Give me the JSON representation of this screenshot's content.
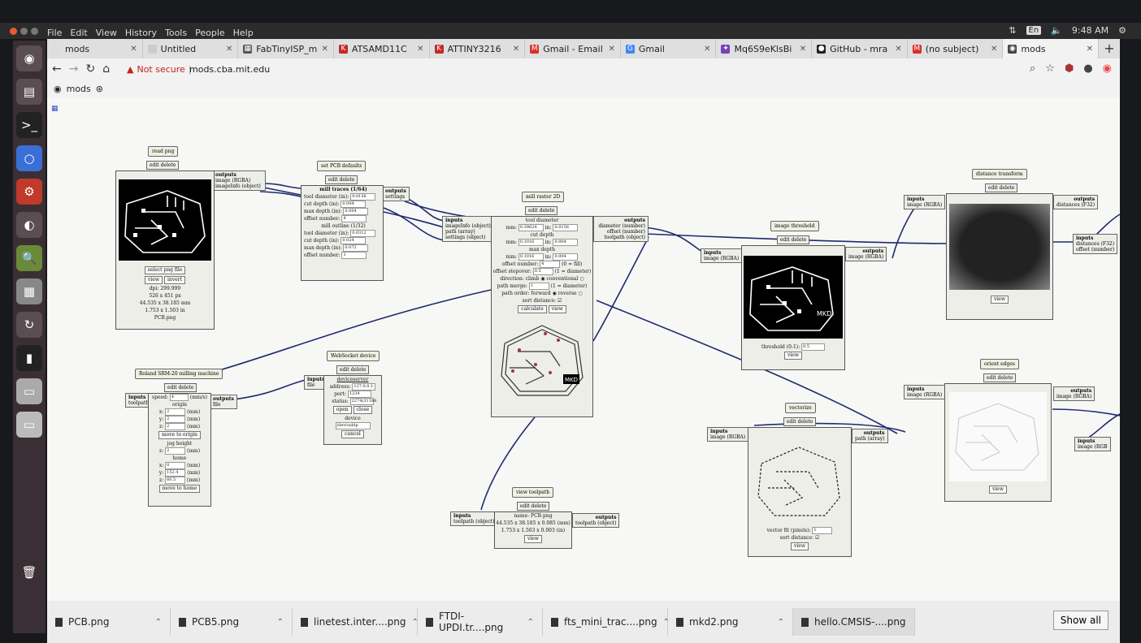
{
  "system": {
    "menu": [
      "File",
      "Edit",
      "View",
      "History",
      "Tools",
      "People",
      "Help"
    ],
    "lang": "En",
    "time": "9:48 AM"
  },
  "browser": {
    "tabs": [
      {
        "label": "mods",
        "icon": "mods-icon",
        "active": false
      },
      {
        "label": "Untitled",
        "icon": "page-icon",
        "active": false
      },
      {
        "label": "FabTinyISP_m",
        "icon": "doc-icon",
        "active": false
      },
      {
        "label": "ATSAMD11C",
        "icon": "k-icon",
        "active": false
      },
      {
        "label": "ATTINY3216",
        "icon": "k-icon",
        "active": false
      },
      {
        "label": "Gmail - Email",
        "icon": "gmail-icon",
        "active": false
      },
      {
        "label": "Gmail",
        "icon": "google-icon",
        "active": false
      },
      {
        "label": "Mq6S9eKlsBi",
        "icon": "puzzle-icon",
        "active": false
      },
      {
        "label": "GitHub - mra",
        "icon": "github-icon",
        "active": false
      },
      {
        "label": "(no subject)",
        "icon": "gmail-icon",
        "active": false
      },
      {
        "label": "mods",
        "icon": "mods-icon",
        "active": true
      }
    ],
    "security": "Not secure",
    "url": "mods.cba.mit.edu",
    "bookmark": "mods"
  },
  "modules": {
    "read_png": {
      "title": "read png",
      "edit": "edit delete",
      "outputs": "outputs",
      "out1": "image (RGBA)",
      "out2": "imageInfo (object)",
      "select": "select png file",
      "view": "view",
      "invert": "invert",
      "dpi": "dpi: 299.999",
      "px": "526 x 451 px",
      "mm": "44.535 x 38.185 mm",
      "in": "1.753 x 1.503 in",
      "name": "PCB.png"
    },
    "pcb_defaults": {
      "title": "set PCB defaults",
      "edit": "edit delete",
      "outputs": "outputs",
      "out1": "settings",
      "h1": "mill traces (1/64)",
      "r1": "tool diameter (in):",
      "v1": "0.0156",
      "r2": "cut depth (in):",
      "v2": "0.004",
      "r3": "max depth (in):",
      "v3": "0.004",
      "r4": "offset number:",
      "v4": "4",
      "h2": "mill outline (1/32)",
      "r5": "tool diameter (in):",
      "v5": "0.0312",
      "r6": "cut depth (in):",
      "v6": "0.024",
      "r7": "max depth (in):",
      "v7": "0.072",
      "r8": "offset number:",
      "v8": "1"
    },
    "raster": {
      "title": "mill raster 2D",
      "edit": "edit delete",
      "inputs": "inputs",
      "in1": "imageInfo (object)",
      "in2": "path (array)",
      "in3": "settings (object)",
      "outputs": "outputs",
      "out1": "diameter (number)",
      "out2": "offset (number)",
      "out3": "toolpath (object)",
      "h1": "tool diameter",
      "r1a": "mm:",
      "v1a": "0.39624",
      "r1b": "in:",
      "v1b": "0.0156",
      "h2": "cut depth",
      "r2a": "mm:",
      "v2a": "0.1016",
      "r2b": "in:",
      "v2b": "0.004",
      "h3": "max depth",
      "r3a": "mm:",
      "v3a": "0.1016",
      "r3b": "in:",
      "v3b": "0.004",
      "r4": "offset number:",
      "v4": "4",
      "r4n": "(0 = fill)",
      "r5": "offset stepover:",
      "v5": "0.5",
      "r5n": "(1 = diameter)",
      "r6": "direction: climb",
      "r6b": "conventional",
      "r7": "path merge:",
      "v7": "1",
      "r7n": "(1 = diameter)",
      "r8": "path order: forward",
      "r8b": "reverse",
      "r9": "sort distance:",
      "calc": "calculate",
      "view": "view",
      "mkd": "MKD"
    },
    "roland": {
      "title": "Roland SRM-20 milling machine",
      "edit": "edit delete",
      "inputs": "inputs",
      "in1": "toolpath",
      "outputs": "outputs",
      "out1": "file",
      "speed": "speed:",
      "speed_v": "4",
      "speed_u": "(mm/s)",
      "origin": "origin",
      "x": "x:",
      "x_v": "2",
      "y": "y:",
      "y_v": "2",
      "z": "z:",
      "z_v": "2",
      "unit": "(mm)",
      "move_origin": "move to origin",
      "jog": "jog height",
      "jog_z": "z:",
      "jog_v": "2",
      "home": "home",
      "hx_v": "0",
      "hy_v": "152.4",
      "hz_v": "60.5",
      "move_home": "move to home"
    },
    "websocket": {
      "title": "WebSocket device",
      "edit": "edit delete",
      "inputs": "inputs",
      "in1": "file",
      "server": "deviceserver",
      "address": "address:",
      "address_v": "127.0.0.1",
      "port": "port:",
      "port_v": "1234",
      "status": "status:",
      "status_v": "2274(31188",
      "open": "open",
      "close": "close",
      "device": "device",
      "device_v": "/dev/usblp",
      "cancel": "cancel"
    },
    "view_toolpath": {
      "title": "view toolpath",
      "edit": "edit delete",
      "inputs": "inputs",
      "in1": "toolpath (object)",
      "outputs": "outputs",
      "out1": "toolpath (object)",
      "name": "name: PCB.png",
      "mm": "44.535 x 38.185 x 0.085 (mm)",
      "in": "1.753 x 1.503 x 0.003 (in)",
      "view": "view"
    },
    "threshold": {
      "title": "image threshold",
      "edit": "edit delete",
      "inputs": "inputs",
      "in1": "image (RGBA)",
      "outputs": "outputs",
      "out1": "image (RGBA)",
      "label": "threshold (0-1):",
      "value": "0.5",
      "view": "view",
      "mkd": "MKD"
    },
    "distance": {
      "title": "distance transform",
      "edit": "edit delete",
      "inputs": "inputs",
      "in1": "image (RGBA)",
      "outputs": "outputs",
      "out1": "distances (F32)",
      "view": "view"
    },
    "offset": {
      "inputs": "inputs",
      "in1": "distances (F32)",
      "in2": "offset (number)"
    },
    "edges": {
      "title": "orient edges",
      "edit": "edit delete",
      "inputs": "inputs",
      "in1": "image (RGBA)",
      "outputs": "outputs",
      "out1": "image (RGBA)",
      "view": "view"
    },
    "vectorize": {
      "title": "vectorize",
      "edit": "edit delete",
      "inputs": "inputs",
      "in1": "image (RGBA)",
      "outputs": "outputs",
      "out1": "path (array)",
      "fit": "vector fit (pixels):",
      "fit_v": "1",
      "sort": "sort distance:",
      "view": "view"
    },
    "partial": {
      "inputs": "inputs",
      "in1": "image (RGB"
    }
  },
  "downloads": {
    "items": [
      "PCB.png",
      "PCB5.png",
      "linetest.inter....png",
      "FTDI-UPDI.tr....png",
      "fts_mini_trac....png",
      "mkd2.png",
      "hello.CMSIS-....png"
    ],
    "show_all": "Show all"
  },
  "colors": {
    "wire": "#1e2a6e",
    "insecure": "#c5221f"
  }
}
